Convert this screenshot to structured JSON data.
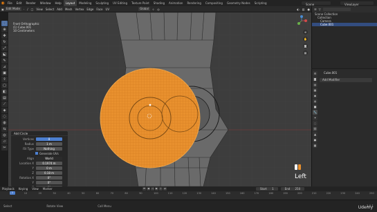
{
  "topbar": {
    "menus": [
      "File",
      "Edit",
      "Render",
      "Window",
      "Help"
    ],
    "tabs": [
      "Layout",
      "Modeling",
      "Sculpting",
      "UV Editing",
      "Texture Paint",
      "Shading",
      "Animation",
      "Rendering",
      "Compositing",
      "Geometry Nodes",
      "Scripting"
    ],
    "active_tab": "Layout",
    "scene": "Scene",
    "view_layer": "ViewLayer"
  },
  "viewport_header": {
    "mode": "Edit Mode",
    "menus": [
      "View",
      "Select",
      "Add",
      "Mesh",
      "Vertex",
      "Edge",
      "Face",
      "UV"
    ],
    "orientation": "Global"
  },
  "viewport": {
    "info_lines": [
      "Front Orthographic",
      "(1) Cube.001",
      "10 Centimeters"
    ],
    "view_label": "Left",
    "accent_color": "#e8902e"
  },
  "operator_panel": {
    "title": "Add Circle",
    "fields": [
      {
        "label": "Vertices",
        "value": "8"
      },
      {
        "label": "Radius",
        "value": "1 m"
      },
      {
        "label": "Fill Type",
        "value": "Nothing"
      }
    ],
    "checkbox": "Generate UVs",
    "align_label": "Align",
    "align_value": "World",
    "location": {
      "label": "Location X",
      "values": [
        "0.1974 m",
        "0 m",
        "0.18 m"
      ],
      "axes": [
        "X",
        "Y",
        "Z"
      ]
    },
    "rotation": {
      "label": "Rotation X",
      "values": [
        "0°",
        "0°",
        "0°"
      ],
      "axes": [
        "X",
        "Y",
        "Z"
      ]
    }
  },
  "timeline": {
    "menus": [
      "Playback",
      "Keying",
      "View",
      "Marker"
    ],
    "current_frame": "1",
    "ticks": [
      "0",
      "10",
      "20",
      "30",
      "40",
      "50",
      "60",
      "70",
      "80",
      "90",
      "100",
      "110",
      "120",
      "130",
      "140",
      "150",
      "160",
      "170",
      "180",
      "190",
      "200",
      "210",
      "220",
      "230",
      "240",
      "250"
    ],
    "start_label": "Start",
    "start": "1",
    "end_label": "End",
    "end": "250"
  },
  "statusbar": {
    "items": [
      "Select",
      "Rotate View",
      "Call Menu"
    ],
    "version": "3.0.1"
  },
  "outliner": {
    "items": [
      "Scene Collection",
      "Collection",
      "Camera",
      "Cube.001"
    ],
    "selected": "Cube.001"
  },
  "properties": {
    "object_name": "Cube.001",
    "add_modifier": "Add Modifier"
  },
  "watermark": "Udemy"
}
